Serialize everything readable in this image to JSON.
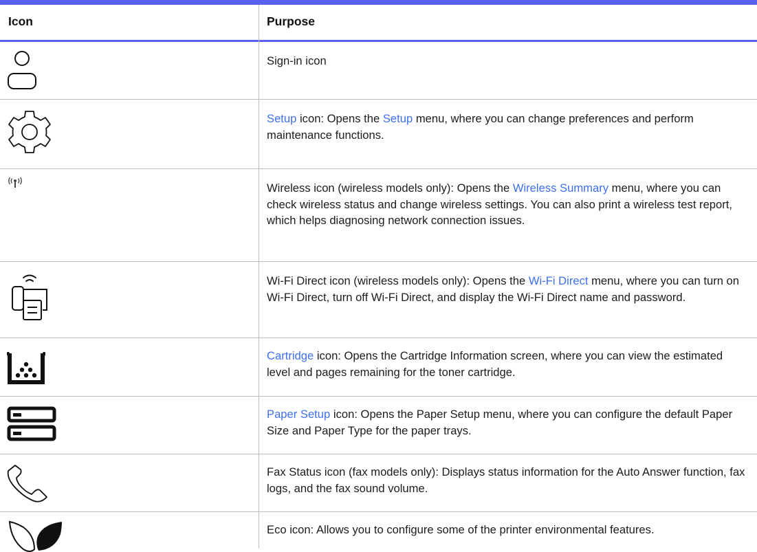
{
  "header": {
    "icon_col": "Icon",
    "purpose_col": "Purpose"
  },
  "colors": {
    "accent": "#5a60f0",
    "link": "#3d6ff0",
    "grid": "#bdbdbd",
    "text": "#1c1c1c"
  },
  "rows": [
    {
      "icon": "sign-in-icon",
      "pre": "Sign-in icon",
      "link1": "",
      "mid": "",
      "link2": "",
      "post": ""
    },
    {
      "icon": "setup-gear-icon",
      "pre": "",
      "link1": "Setup",
      "mid": " icon: Opens the ",
      "link2": "Setup",
      "post": " menu, where you can change preferences and perform maintenance functions."
    },
    {
      "icon": "wireless-icon",
      "pre": "Wireless icon (wireless models only): Opens the ",
      "link1": "Wireless Summary",
      "mid": " menu, where you can check wireless status and change wireless settings. You can also print a wireless test report, which helps diagnosing network connection issues.",
      "link2": "",
      "post": ""
    },
    {
      "icon": "wifi-direct-icon",
      "pre": "Wi-Fi Direct icon (wireless models only): Opens the ",
      "link1": "Wi-Fi Direct",
      "mid": " menu, where you can turn on Wi-Fi Direct, turn off Wi-Fi Direct, and display the Wi-Fi Direct name and password.",
      "link2": "",
      "post": ""
    },
    {
      "icon": "cartridge-icon",
      "pre": "",
      "link1": "Cartridge",
      "mid": " icon: Opens the Cartridge Information screen, where you can view the estimated level and pages remaining for the toner cartridge.",
      "link2": "",
      "post": ""
    },
    {
      "icon": "paper-setup-icon",
      "pre": "",
      "link1": "Paper Setup",
      "mid": " icon: Opens the Paper Setup menu, where you can configure the default Paper Size and Paper Type for the paper trays.",
      "link2": "",
      "post": ""
    },
    {
      "icon": "fax-status-icon",
      "pre": "Fax Status icon (fax models only): Displays status information for the Auto Answer function, fax logs, and the fax sound volume.",
      "link1": "",
      "mid": "",
      "link2": "",
      "post": ""
    },
    {
      "icon": "eco-icon",
      "pre": "Eco icon: Allows you to configure some of the printer environmental features.",
      "link1": "",
      "mid": "",
      "link2": "",
      "post": ""
    }
  ]
}
